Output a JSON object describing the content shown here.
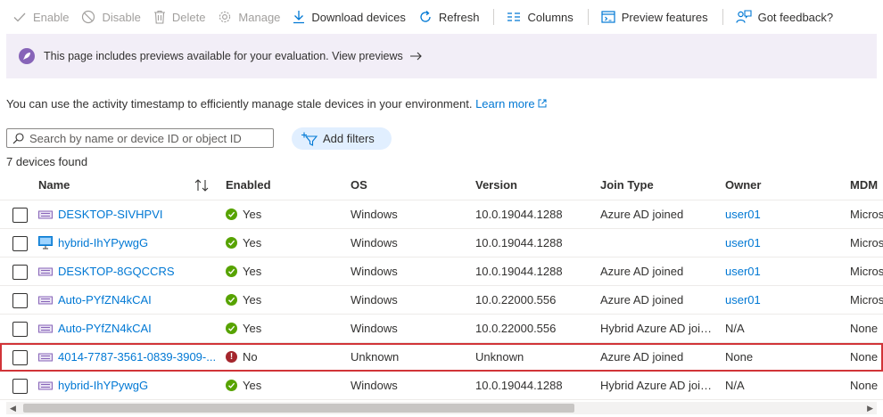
{
  "toolbar": {
    "enable": "Enable",
    "disable": "Disable",
    "delete": "Delete",
    "manage": "Manage",
    "download": "Download devices",
    "refresh": "Refresh",
    "columns": "Columns",
    "preview": "Preview features",
    "feedback": "Got feedback?"
  },
  "banner": {
    "text": "This page includes previews available for your evaluation. View previews"
  },
  "info": {
    "text": "You can use the activity timestamp to efficiently manage stale devices in your environment.",
    "link": "Learn more"
  },
  "search": {
    "placeholder": "Search by name or device ID or object ID"
  },
  "filters": {
    "label": "Add filters"
  },
  "results": {
    "count": "7 devices found"
  },
  "table": {
    "columns": {
      "name": "Name",
      "enabled": "Enabled",
      "os": "OS",
      "version": "Version",
      "join": "Join Type",
      "owner": "Owner",
      "mdm": "MDM"
    },
    "rows": [
      {
        "name": "DESKTOP-SIVHPVI",
        "icon": "device-icon",
        "enabled": "Yes",
        "os": "Windows",
        "version": "10.0.19044.1288",
        "join": "Azure AD joined",
        "owner": "user01",
        "mdm": "Microsoft Intune"
      },
      {
        "name": "hybrid-IhYPywgG",
        "icon": "monitor-icon",
        "enabled": "Yes",
        "os": "Windows",
        "version": "10.0.19044.1288",
        "join": "",
        "owner": "user01",
        "mdm": "Microsoft Intune"
      },
      {
        "name": "DESKTOP-8GQCCRS",
        "icon": "device-icon",
        "enabled": "Yes",
        "os": "Windows",
        "version": "10.0.19044.1288",
        "join": "Azure AD joined",
        "owner": "user01",
        "mdm": "Microsoft Intune"
      },
      {
        "name": "Auto-PYfZN4kCAI",
        "icon": "device-icon",
        "enabled": "Yes",
        "os": "Windows",
        "version": "10.0.22000.556",
        "join": "Azure AD joined",
        "owner": "user01",
        "mdm": "Microsoft Intune"
      },
      {
        "name": "Auto-PYfZN4kCAI",
        "icon": "device-icon",
        "enabled": "Yes",
        "os": "Windows",
        "version": "10.0.22000.556",
        "join": "Hybrid Azure AD joined",
        "owner": "N/A",
        "mdm": "None"
      },
      {
        "name": "4014-7787-3561-0839-3909-...",
        "icon": "device-icon",
        "enabled": "No",
        "os": "Unknown",
        "version": "Unknown",
        "join": "Azure AD joined",
        "owner": "None",
        "mdm": "None"
      },
      {
        "name": "hybrid-IhYPywgG",
        "icon": "device-icon",
        "enabled": "Yes",
        "os": "Windows",
        "version": "10.0.19044.1288",
        "join": "Hybrid Azure AD joined",
        "owner": "N/A",
        "mdm": "None"
      }
    ]
  },
  "colors": {
    "accent": "#0078d4",
    "success": "#57a300",
    "error": "#a4262c",
    "banner_bg": "#f2eef7",
    "selection": "#d13438"
  }
}
